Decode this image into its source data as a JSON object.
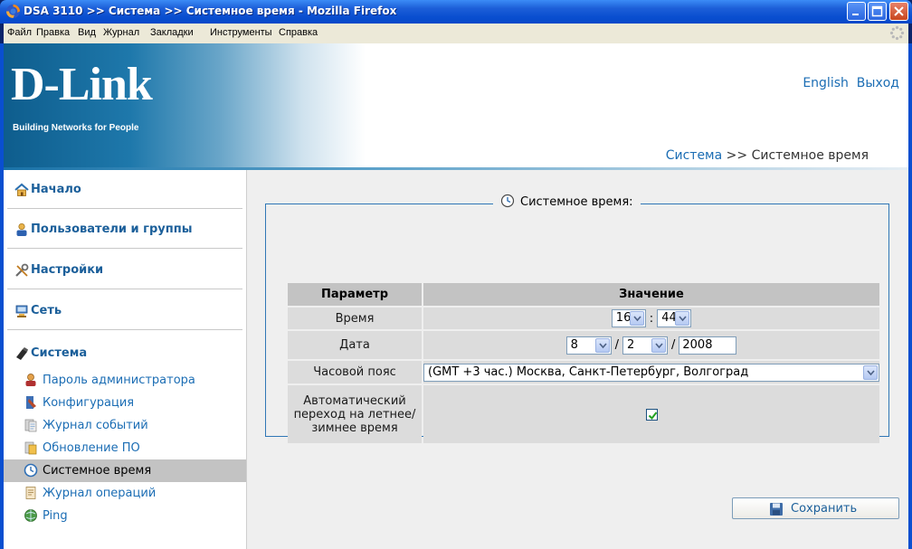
{
  "window": {
    "title": "DSA 3110 >> Система >> Системное время - Mozilla Firefox"
  },
  "menubar": {
    "items": [
      "Файл",
      "Правка",
      "Вид",
      "Журнал",
      "Закладки",
      "Инструменты",
      "Справка"
    ]
  },
  "header": {
    "logo": "D-Link",
    "tagline": "Building Networks for People",
    "link_english": "English",
    "link_logout": "Выход",
    "breadcrumb_link": "Система",
    "breadcrumb_sep": " >> ",
    "breadcrumb_current": "Системное время"
  },
  "sidebar": {
    "home": "Начало",
    "users": "Пользователи и группы",
    "settings": "Настройки",
    "network": "Сеть",
    "system": "Система",
    "sub_items": [
      "Пароль администратора",
      "Конфигурация",
      "Журнал событий",
      "Обновление ПО",
      "Системное время",
      "Журнал операций",
      "Ping"
    ],
    "active_item": "Системное время"
  },
  "panel": {
    "legend": "Системное время:",
    "col_param": "Параметр",
    "col_value": "Значение",
    "rows": {
      "time_label": "Время",
      "date_label": "Дата",
      "tz_label": "Часовой пояс",
      "dst_label": "Автоматический переход на летнее/зимнее время"
    },
    "time": {
      "hour": "16",
      "minute": "44",
      "separator": ":"
    },
    "date": {
      "day": "8",
      "month": "2",
      "year": "2008",
      "separator": "/"
    },
    "timezone": "(GMT +3 час.) Москва, Санкт-Петербург, Волгоград",
    "dst_enabled": true,
    "save_label": "Сохранить"
  },
  "colors": {
    "link": "#1b6db4",
    "header_gradient_start": "#0e5d8d",
    "table_header": "#c3c3c3",
    "table_cell": "#dcdcdc",
    "panel_bg": "#efefef",
    "fieldset_border": "#2f77b6",
    "active_item": "#c3c3c3"
  }
}
